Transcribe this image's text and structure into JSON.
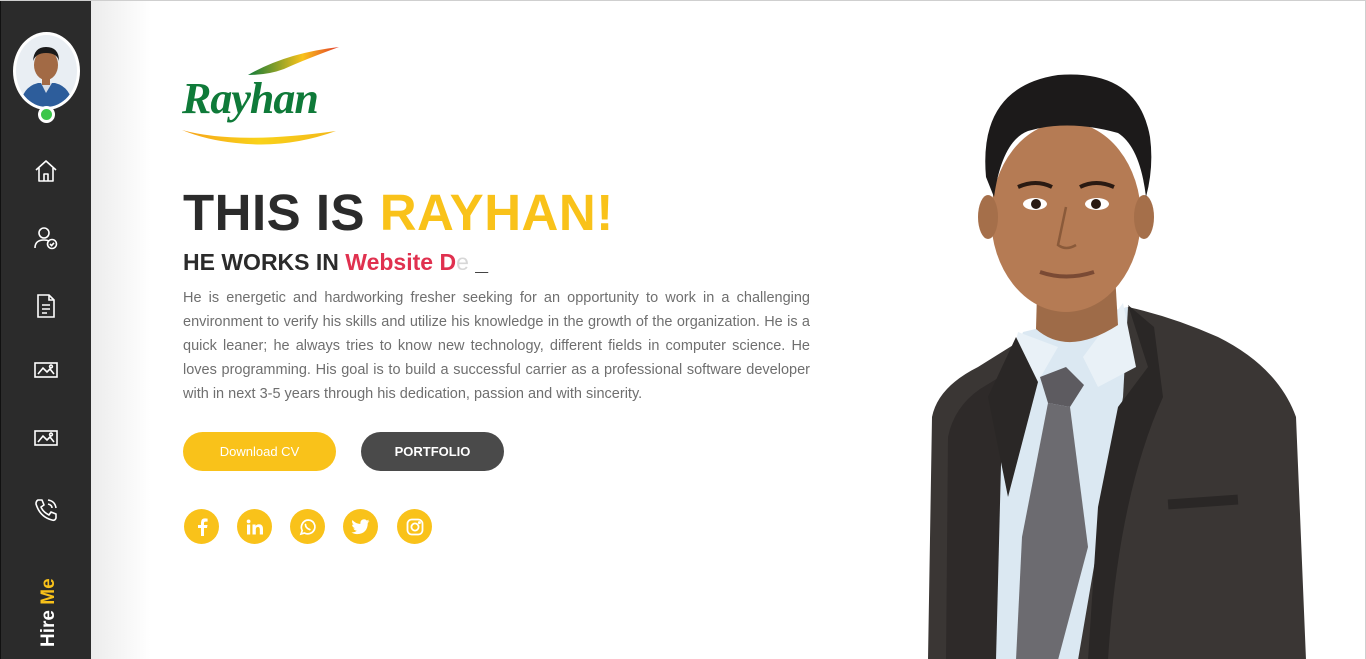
{
  "sidebar": {
    "nav": [
      {
        "name": "home",
        "icon": "home-icon"
      },
      {
        "name": "about",
        "icon": "user-check-icon"
      },
      {
        "name": "resume",
        "icon": "document-icon"
      },
      {
        "name": "portfolio",
        "icon": "image-gallery-icon"
      },
      {
        "name": "gallery",
        "icon": "image-gallery-icon"
      },
      {
        "name": "contact",
        "icon": "phone-icon"
      }
    ],
    "hire_label_1": "Hire",
    "hire_label_2": "Me",
    "status": "online"
  },
  "logo": {
    "text": "Rayhan"
  },
  "hero": {
    "title_prefix": "THIS IS",
    "title_name": "RAYHAN!",
    "works_prefix": "HE WORKS IN",
    "works_typed": "Website D",
    "works_ghost": "e",
    "works_cursor": "_",
    "description": "He is energetic and hardworking fresher seeking for an opportunity to work in a challenging environment to verify his skills and utilize his knowledge in the growth of the organization. He is a quick leaner; he always tries to know new technology, different fields in computer science. He loves programming. His goal is to build a successful carrier as a professional software developer with in next 3-5 years through his dedication, passion and with sincerity.",
    "download_cv": "Download CV",
    "portfolio": "PORTFOLIO"
  },
  "social": [
    "facebook-icon",
    "linkedin-icon",
    "whatsapp-icon",
    "twitter-icon",
    "instagram-icon"
  ],
  "colors": {
    "accent": "#f9c21a",
    "typed": "#e0314f",
    "sidebar": "#2b2b2b",
    "dark_button": "#4a4a4a",
    "online": "#3cc64a",
    "logo_green": "#0f7a39"
  }
}
